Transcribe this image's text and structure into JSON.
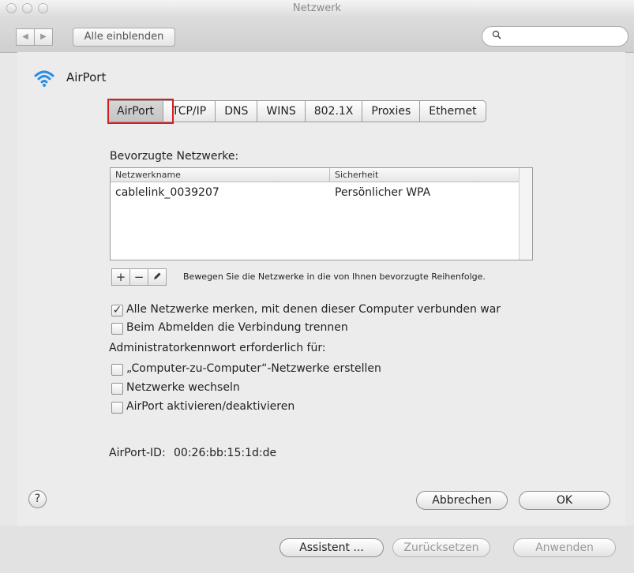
{
  "window": {
    "title": "Netzwerk"
  },
  "toolbar": {
    "back_icon": "◀",
    "forward_icon": "▶",
    "show_all_label": "Alle einblenden",
    "search_placeholder": ""
  },
  "header": {
    "title": "AirPort"
  },
  "tabs": [
    {
      "label": "AirPort",
      "active": true
    },
    {
      "label": "TCP/IP"
    },
    {
      "label": "DNS"
    },
    {
      "label": "WINS"
    },
    {
      "label": "802.1X"
    },
    {
      "label": "Proxies"
    },
    {
      "label": "Ethernet"
    }
  ],
  "preferred": {
    "heading": "Bevorzugte Netzwerke:",
    "columns": {
      "name": "Netzwerkname",
      "security": "Sicherheit"
    },
    "rows": [
      {
        "name": "cablelink_0039207",
        "security": "Persönlicher WPA"
      }
    ],
    "add_label": "+",
    "remove_label": "−",
    "hint": "Bewegen Sie die Netzwerke in die von Ihnen bevorzugte Reihenfolge."
  },
  "options": {
    "remember_all": {
      "label": "Alle Netzwerke merken, mit denen dieser Computer verbunden war",
      "checked": true
    },
    "disconnect_logout": {
      "label": "Beim Abmelden die Verbindung trennen",
      "checked": false
    },
    "admin_heading": "Administratorkennwort erforderlich für:",
    "create_c2c": {
      "label": "„Computer-zu-Computer“-Netzwerke erstellen",
      "checked": false
    },
    "change_networks": {
      "label": "Netzwerke wechseln",
      "checked": false
    },
    "toggle_airport": {
      "label": "AirPort aktivieren/deaktivieren",
      "checked": false
    }
  },
  "airport_id": {
    "label": "AirPort-ID:",
    "value": "00:26:bb:15:1d:de"
  },
  "dialog_buttons": {
    "help": "?",
    "cancel": "Abbrechen",
    "ok": "OK"
  },
  "footer_buttons": {
    "assistant": "Assistent ...",
    "revert": "Zurücksetzen",
    "apply": "Anwenden"
  },
  "colors": {
    "highlight": "#d42020",
    "window_bg": "#e8e8e8"
  }
}
